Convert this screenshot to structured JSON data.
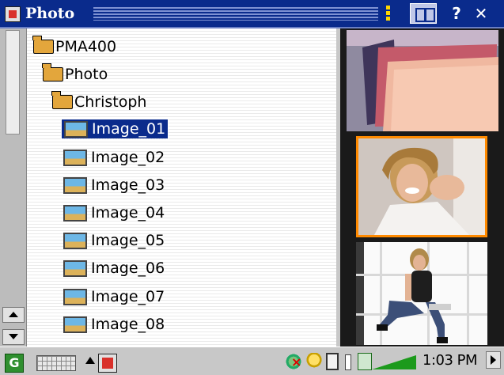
{
  "window": {
    "title": "Photo",
    "help_label": "?",
    "close_label": "✕"
  },
  "tree": {
    "root": "PMA400",
    "folder": "Photo",
    "subfolder": "Christoph",
    "files": [
      "Image_01",
      "Image_02",
      "Image_03",
      "Image_04",
      "Image_05",
      "Image_06",
      "Image_07",
      "Image_08"
    ],
    "selected": "Image_01"
  },
  "taskbar": {
    "start_label": "G",
    "clock": "1:03 PM"
  },
  "colors": {
    "titlebar": "#0a2b8c",
    "selection": "#0a2b8c",
    "thumb_highlight": "#ff8a00"
  }
}
